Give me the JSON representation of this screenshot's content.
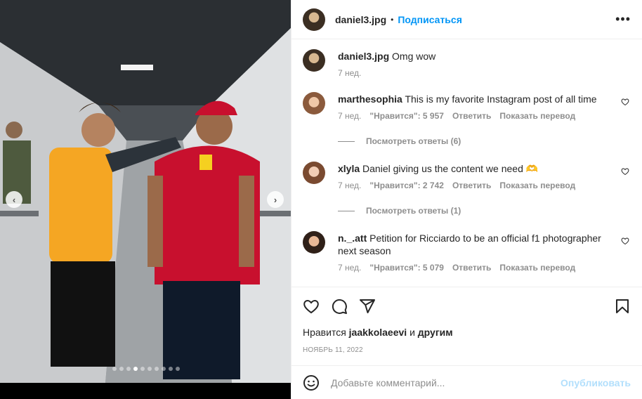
{
  "post": {
    "username": "daniel3.jpg",
    "follow_label": "Подписаться",
    "separator": "•",
    "more_label": "•••",
    "carousel": {
      "prev": "‹",
      "next": "›",
      "count": 10,
      "active": 3
    },
    "caption": {
      "username": "daniel3.jpg",
      "text": "Omg wow",
      "time": "7 нед."
    }
  },
  "comments": [
    {
      "username": "marthesophia",
      "text": "This is my favorite Instagram post of all time",
      "time": "7 нед.",
      "likes": "\"Нравится\": 5 957",
      "reply": "Ответить",
      "translate": "Показать перевод",
      "view_replies": "Посмотреть ответы (6)"
    },
    {
      "username": "xlyla",
      "text": "Daniel giving us the content we need 🫶",
      "time": "7 нед.",
      "likes": "\"Нравится\": 2 742",
      "reply": "Ответить",
      "translate": "Показать перевод",
      "view_replies": "Посмотреть ответы (1)"
    },
    {
      "username": "n._.att",
      "text": "Petition for Ricciardo to be an official f1 photographer next season",
      "time": "7 нед.",
      "likes": "\"Нравится\": 5 079",
      "reply": "Ответить",
      "translate": "Показать перевод"
    }
  ],
  "footer": {
    "likes_prefix": "Нравится",
    "likes_user": "jaakkolaeevi",
    "likes_and": "и",
    "likes_others": "другим",
    "date": "НОЯБРЬ 11, 2022",
    "comment_placeholder": "Добавьте комментарий...",
    "post_label": "Опубликовать"
  },
  "colors": {
    "link": "#0095f6",
    "post_disabled": "#b2dffc",
    "muted": "#8e8e8e"
  }
}
